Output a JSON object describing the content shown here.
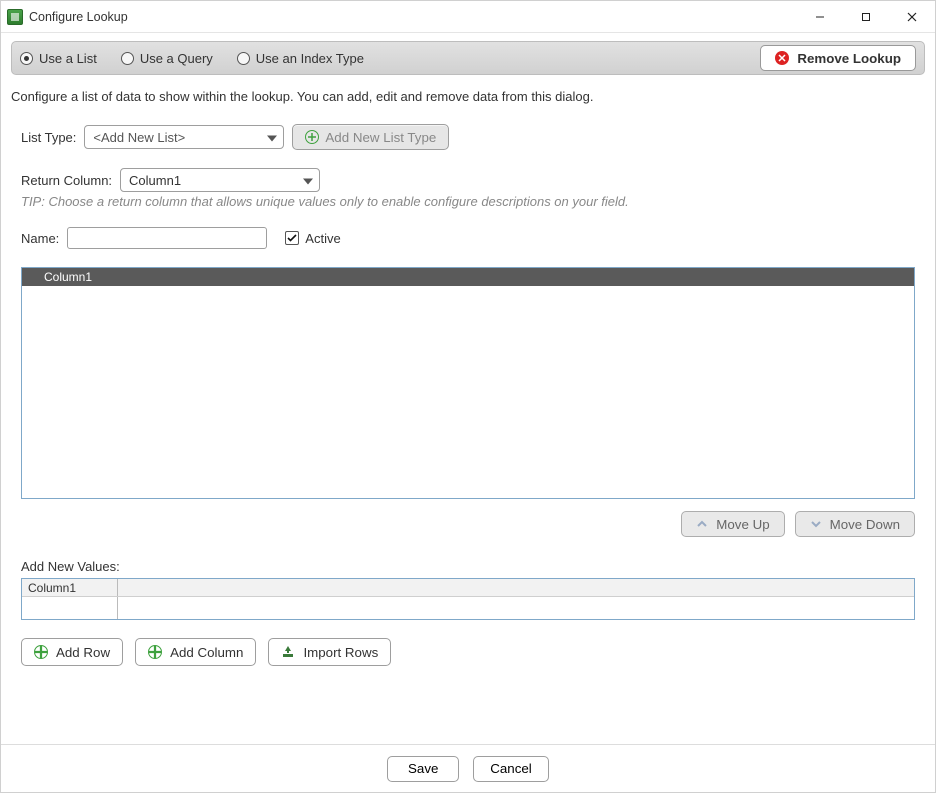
{
  "window": {
    "title": "Configure Lookup"
  },
  "srcbar": {
    "use_list": "Use a List",
    "use_query": "Use a Query",
    "use_index": "Use an Index Type",
    "remove": "Remove Lookup"
  },
  "description": "Configure a list of data to show within the lookup. You can add, edit and remove data from this dialog.",
  "listtype": {
    "label": "List Type:",
    "value": "<Add New List>",
    "add_btn": "Add New List Type"
  },
  "returncol": {
    "label": "Return Column:",
    "value": "Column1"
  },
  "tip": "TIP: Choose a return column that allows unique values only to enable configure descriptions on your field.",
  "name": {
    "label": "Name:",
    "value": ""
  },
  "active": {
    "label": "Active",
    "checked": true
  },
  "grid": {
    "header": "Column1"
  },
  "move": {
    "up": "Move Up",
    "down": "Move Down"
  },
  "addvalues": {
    "label": "Add New Values:",
    "col1": "Column1"
  },
  "tools": {
    "add_row": "Add Row",
    "add_column": "Add Column",
    "import_rows": "Import Rows"
  },
  "footer": {
    "save": "Save",
    "cancel": "Cancel"
  }
}
